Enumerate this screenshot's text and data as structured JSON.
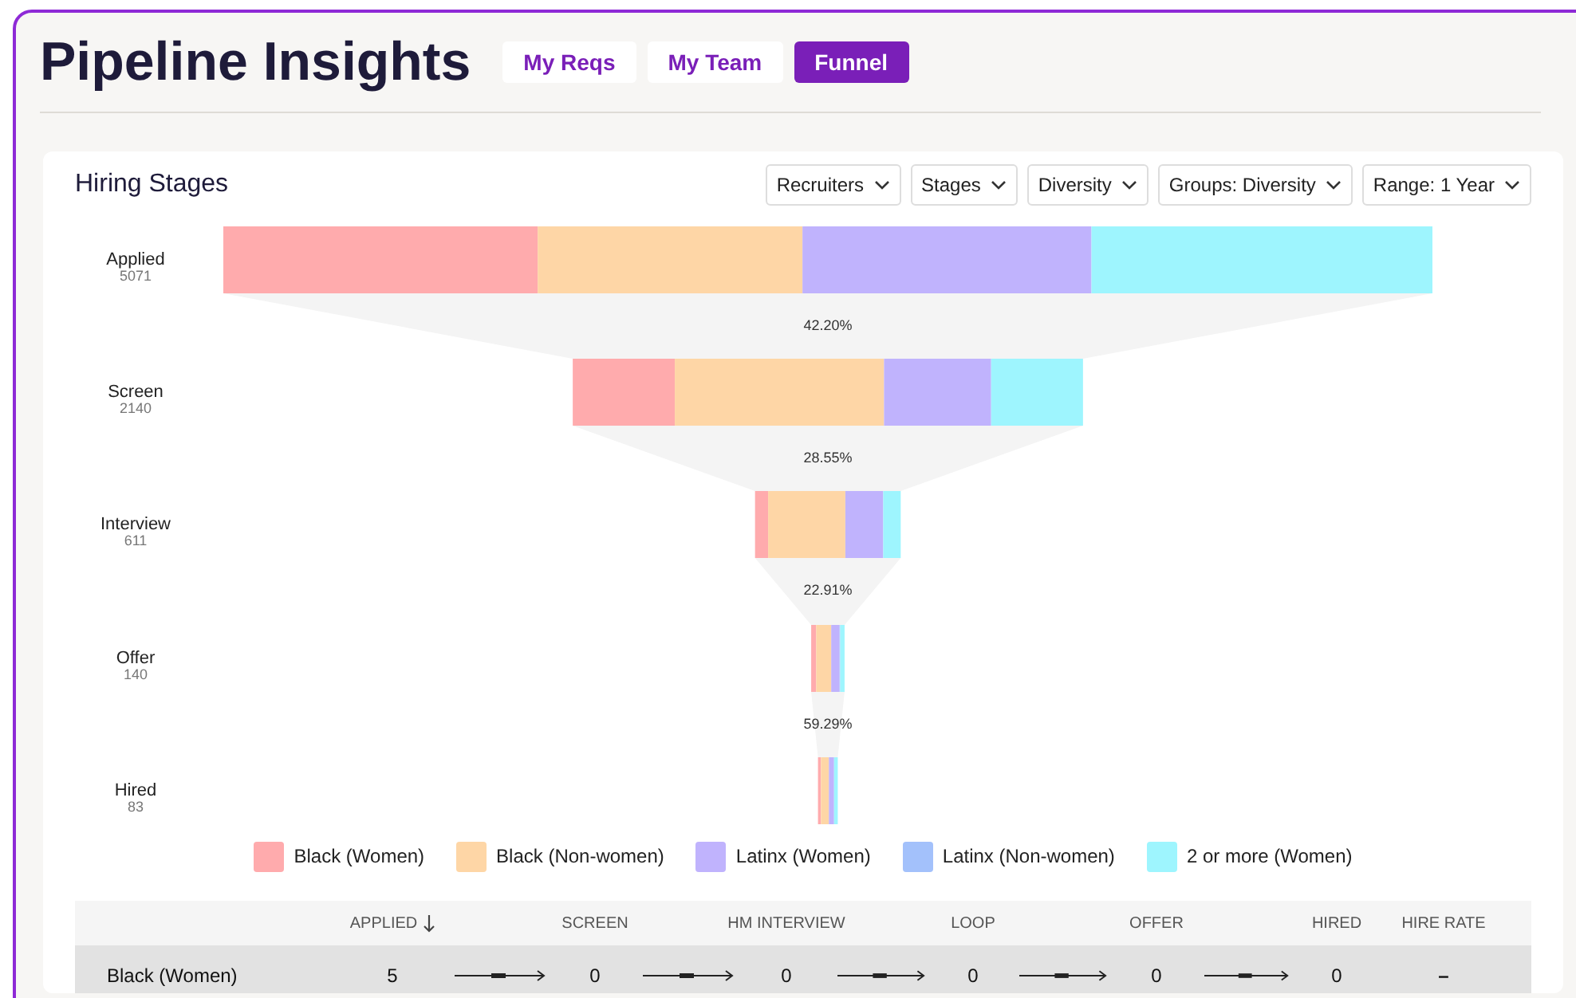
{
  "title": "Pipeline Insights",
  "tabs": [
    {
      "label": "My Reqs",
      "selected": false
    },
    {
      "label": "My Team",
      "selected": false
    },
    {
      "label": "Funnel",
      "selected": true
    }
  ],
  "card": {
    "title": "Hiring Stages",
    "filters": [
      "Recruiters",
      "Stages",
      "Diversity",
      "Groups: Diversity",
      "Range: 1 Year"
    ],
    "stages": [
      {
        "name": "Applied",
        "count": "5071"
      },
      {
        "name": "Screen",
        "count": "2140"
      },
      {
        "name": "Interview",
        "count": "611"
      },
      {
        "name": "Offer",
        "count": "140"
      },
      {
        "name": "Hired",
        "count": "83"
      }
    ],
    "conversions": [
      "42.20%",
      "28.55%",
      "22.91%",
      "59.29%"
    ],
    "legend": [
      {
        "label": "Black (Women)",
        "color": "#ffabad"
      },
      {
        "label": "Black (Non-women)",
        "color": "#fed6a6"
      },
      {
        "label": "Latinx (Women)",
        "color": "#c0b3fd"
      },
      {
        "label": "Latinx (Non-women)",
        "color": "#a3c1fb"
      },
      {
        "label": "2 or more (Women)",
        "color": "#9ef5fe"
      }
    ],
    "table": {
      "columns": [
        "APPLIED",
        "SCREEN",
        "HM INTERVIEW",
        "LOOP",
        "OFFER",
        "HIRED",
        "HIRE RATE"
      ],
      "rows": [
        {
          "name": "Black (Women)",
          "values": [
            "5",
            "0",
            "0",
            "0",
            "0",
            "0",
            "–"
          ]
        }
      ]
    }
  }
}
